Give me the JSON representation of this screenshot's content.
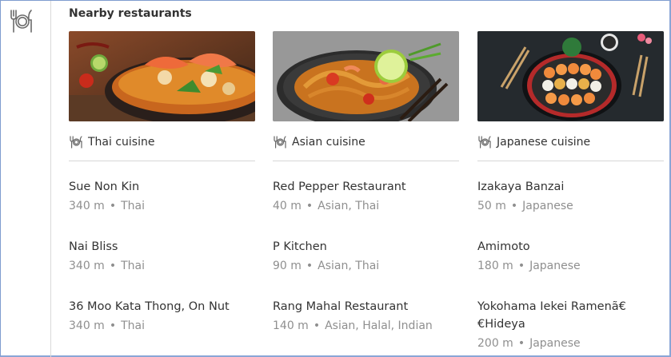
{
  "section": {
    "title": "Nearby restaurants",
    "icon": "restaurant-icon"
  },
  "columns": [
    {
      "cuisine": "Thai cuisine",
      "photo_alt": "tom-yum-soup-photo",
      "restaurants": [
        {
          "name": "Sue Non Kin",
          "distance": "340 m",
          "tags": "Thai"
        },
        {
          "name": "Nai Bliss",
          "distance": "340 m",
          "tags": "Thai"
        },
        {
          "name": "36 Moo Kata Thong, On Nut",
          "distance": "340 m",
          "tags": "Thai"
        }
      ]
    },
    {
      "cuisine": "Asian cuisine",
      "photo_alt": "noodle-dish-photo",
      "restaurants": [
        {
          "name": "Red Pepper Restaurant",
          "distance": "40 m",
          "tags": "Asian, Thai"
        },
        {
          "name": "P Kitchen",
          "distance": "90 m",
          "tags": "Asian, Thai"
        },
        {
          "name": "Rang Mahal Restaurant",
          "distance": "140 m",
          "tags": "Asian, Halal, Indian"
        }
      ]
    },
    {
      "cuisine": "Japanese cuisine",
      "photo_alt": "sushi-platter-photo",
      "restaurants": [
        {
          "name": "Izakaya Banzai",
          "distance": "50 m",
          "tags": "Japanese"
        },
        {
          "name": "Amimoto",
          "distance": "180 m",
          "tags": "Japanese"
        },
        {
          "name": "Yokohama Iekei Ramenã€€Hideya",
          "distance": "200 m",
          "tags": "Japanese"
        }
      ]
    }
  ],
  "separator": "•"
}
